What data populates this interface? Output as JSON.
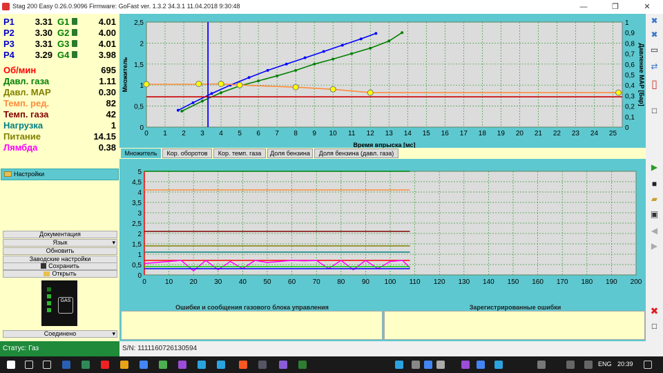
{
  "window": {
    "title": "Stag 200 Easy 0.26.0.9096 Firmware: GoFast  ver. 1.3.2  34.3.1   11.04.2018 9:30:48",
    "minimize": "—",
    "restore": "❐",
    "close": "✕"
  },
  "injectors": [
    {
      "p_label": "P1",
      "p_value": "3.31",
      "g_label": "G1",
      "g_value": "4.01"
    },
    {
      "p_label": "P2",
      "p_value": "3.30",
      "g_label": "G2",
      "g_value": "4.00"
    },
    {
      "p_label": "P3",
      "p_value": "3.31",
      "g_label": "G3",
      "g_value": "4.01"
    },
    {
      "p_label": "P4",
      "p_value": "3.29",
      "g_label": "G4",
      "g_value": "3.98"
    }
  ],
  "params": [
    {
      "label": "Об/мин",
      "value": "695",
      "color": "#ff0000"
    },
    {
      "label": "Давл. газа",
      "value": "1.11",
      "color": "#008000"
    },
    {
      "label": "Давл. MAP",
      "value": "0.30",
      "color": "#808000"
    },
    {
      "label": "Темп. ред.",
      "value": "82",
      "color": "#ff8c3c"
    },
    {
      "label": "Темп. газа",
      "value": "42",
      "color": "#800000"
    },
    {
      "label": "Нагрузка",
      "value": "1",
      "color": "#008080"
    },
    {
      "label": "Питание",
      "value": "14.15",
      "color": "#808000"
    },
    {
      "label": "Лямбда",
      "value": "0.38",
      "color": "#ff00ff"
    }
  ],
  "sidebar": {
    "settings": "Настройки",
    "buttons": [
      "Документация",
      "Язык",
      "Обновить",
      "Заводские настройки",
      "Сохранить",
      "Открыть"
    ],
    "gas_label": "GAS",
    "connection": "Соединено"
  },
  "status": {
    "text": "Статус: Газ",
    "serial": "S/N: 1111160726130594"
  },
  "tabs": [
    "Множитель",
    "Кор. оборотов",
    "Кор. темп. газа",
    "Доля бензина",
    "Доля бензина (давл. газа)"
  ],
  "errors": {
    "left": "Ошибки и сообщения газового блока управления",
    "right": "Зарегистрированные ошибки"
  },
  "taskbar": {
    "lang": "ENG",
    "time": "20:39"
  },
  "colors": {
    "panel": "#ffffc8",
    "accent": "#5ec8d0",
    "status_green": "#1e8a3a"
  },
  "chart_data": [
    {
      "type": "line",
      "xlabel": "Время впрыска [мс]",
      "ylabel": "Множитель",
      "y2label": "Давление MAP [Бар]",
      "xlim": [
        0,
        25.5
      ],
      "ylim": [
        0,
        2.5
      ],
      "y2lim": [
        0,
        1
      ],
      "xticks": [
        0,
        1,
        2,
        3,
        4,
        5,
        6,
        7,
        8,
        9,
        10,
        11,
        12,
        13,
        14,
        15,
        16,
        17,
        18,
        19,
        20,
        21,
        22,
        23,
        24,
        25
      ],
      "yticks": [
        "0",
        "0,5",
        "1",
        "1,5",
        "2",
        "2,5"
      ],
      "y2ticks": [
        "0",
        "0,1",
        "0,2",
        "0,3",
        "0,4",
        "0,5",
        "0,6",
        "0,7",
        "0,8",
        "0,9",
        "1"
      ],
      "grid": true,
      "cursor_x": 3.3,
      "series": [
        {
          "color": "#0000ff",
          "x": [
            1.7,
            2.5,
            3.5,
            4.5,
            5.5,
            6.5,
            7.5,
            8.5,
            9.5,
            10.5,
            11.5,
            12.3
          ],
          "y": [
            0.4,
            0.58,
            0.8,
            1.0,
            1.18,
            1.35,
            1.5,
            1.65,
            1.8,
            1.95,
            2.1,
            2.23
          ]
        },
        {
          "color": "#008000",
          "x": [
            1.9,
            3.0,
            4.0,
            5.0,
            6.0,
            7.0,
            8.0,
            9.0,
            10.0,
            11.0,
            12.0,
            13.0,
            13.7
          ],
          "y": [
            0.38,
            0.62,
            0.82,
            0.98,
            1.1,
            1.22,
            1.35,
            1.5,
            1.62,
            1.75,
            1.88,
            2.05,
            2.25
          ]
        },
        {
          "color": "#ff8c3c",
          "x": [
            0,
            2.8,
            4,
            5,
            8,
            10,
            12,
            25.5
          ],
          "y": [
            1.02,
            1.02,
            1.03,
            1.0,
            0.95,
            0.9,
            0.82,
            0.82
          ]
        },
        {
          "color": "#cc0000",
          "x": [
            0,
            25.5
          ],
          "y": [
            0.72,
            0.72
          ]
        }
      ],
      "points": [
        {
          "x": 0,
          "y": 1.02
        },
        {
          "x": 2.8,
          "y": 1.03
        },
        {
          "x": 4,
          "y": 1.03
        },
        {
          "x": 5,
          "y": 1.0
        },
        {
          "x": 8,
          "y": 0.95
        },
        {
          "x": 10,
          "y": 0.9
        },
        {
          "x": 12,
          "y": 0.82
        },
        {
          "x": 25.3,
          "y": 0.82
        }
      ]
    },
    {
      "type": "line",
      "xlim": [
        0,
        200
      ],
      "ylim": [
        0,
        5
      ],
      "xticks": [
        0,
        10,
        20,
        30,
        40,
        50,
        60,
        70,
        80,
        90,
        100,
        110,
        120,
        130,
        140,
        150,
        160,
        170,
        180,
        190,
        200
      ],
      "yticks": [
        "0",
        "0,5",
        "1",
        "1,5",
        "2",
        "2,5",
        "3",
        "3,5",
        "4",
        "4,5",
        "5"
      ],
      "grid": true,
      "series": [
        {
          "color": "#008000",
          "x": [
            0,
            108
          ],
          "y": [
            5.0,
            5.0
          ]
        },
        {
          "color": "#ff8c3c",
          "x": [
            0,
            108
          ],
          "y": [
            4.1,
            4.1
          ]
        },
        {
          "color": "#800000",
          "x": [
            0,
            108
          ],
          "y": [
            2.1,
            2.1
          ]
        },
        {
          "color": "#808000",
          "x": [
            0,
            108
          ],
          "y": [
            1.4,
            1.4
          ]
        },
        {
          "color": "#008080",
          "x": [
            0,
            108
          ],
          "y": [
            1.1,
            1.1
          ]
        },
        {
          "color": "#ff0000",
          "x": [
            0,
            108
          ],
          "y": [
            0.7,
            0.7
          ]
        },
        {
          "color": "#ff00ff",
          "x": [
            0,
            5,
            10,
            15,
            20,
            25,
            30,
            35,
            40,
            45,
            50,
            55,
            60,
            65,
            70,
            75,
            80,
            85,
            90,
            95,
            100,
            105,
            108
          ],
          "y": [
            0.55,
            0.6,
            0.65,
            0.7,
            0.2,
            0.7,
            0.25,
            0.65,
            0.3,
            0.7,
            0.6,
            0.65,
            0.7,
            0.68,
            0.7,
            0.3,
            0.7,
            0.25,
            0.7,
            0.3,
            0.65,
            0.7,
            0.35
          ]
        },
        {
          "color": "#0000ff",
          "x": [
            0,
            108
          ],
          "y": [
            0.3,
            0.3
          ]
        },
        {
          "color": "#00cc00",
          "x": [
            0,
            108
          ],
          "y": [
            0.4,
            0.4
          ]
        }
      ]
    }
  ]
}
